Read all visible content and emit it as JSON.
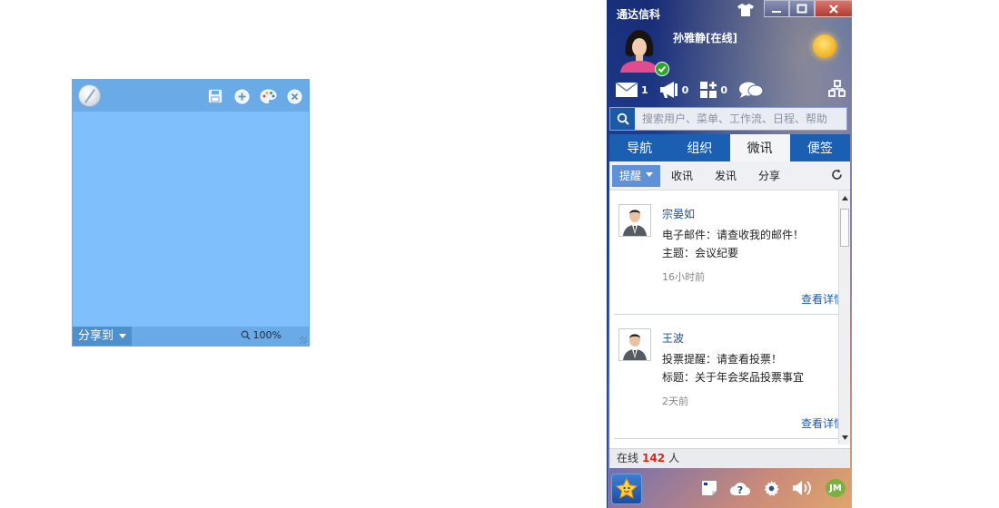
{
  "note": {
    "share_label": "分享到",
    "zoom": "100%",
    "color": "#7fbffb"
  },
  "panel": {
    "app_title": "通达信科",
    "user_name": "孙雅静[在线]",
    "quick": {
      "mail_count": "1",
      "notice_count": "0",
      "app_count": "0"
    },
    "search_placeholder": "搜索用户、菜单、工作流、日程、帮助",
    "tabs": [
      "导航",
      "组织",
      "微讯",
      "便签"
    ],
    "active_tab": "微讯",
    "subtabs": [
      "提醒",
      "收讯",
      "发讯",
      "分享"
    ],
    "messages": [
      {
        "sender": "宗晏如",
        "line1": "电子邮件：请查收我的邮件！",
        "line2": "主题：会议纪要",
        "time": "16小时前",
        "link": "查看详情"
      },
      {
        "sender": "王波",
        "line1": "投票提醒：请查看投票！",
        "line2": "标题：关于年会奖品投票事宜",
        "time": "2天前",
        "link": "查看详情"
      }
    ],
    "online": {
      "prefix": "在线",
      "count": "142",
      "suffix": "人"
    },
    "bottom_jm": "JM"
  }
}
